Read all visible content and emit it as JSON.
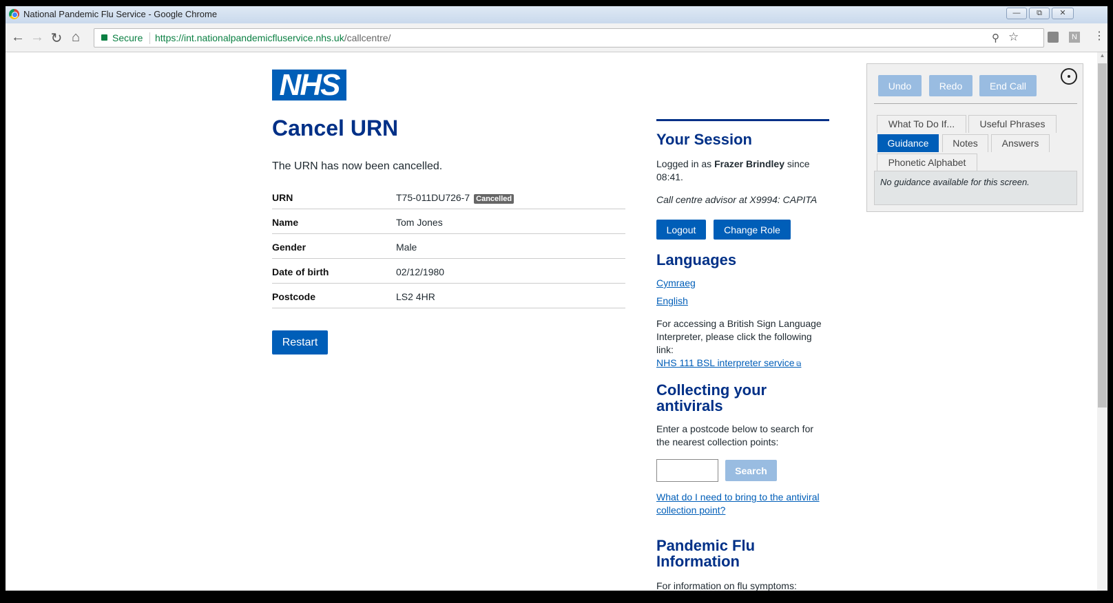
{
  "window": {
    "title": "National Pandemic Flu Service - Google Chrome"
  },
  "browser": {
    "secure_label": "Secure",
    "url_host": "https://int.nationalpandemicfluservice.nhs.uk",
    "url_path": "/callcentre/",
    "ext_n": "N"
  },
  "logo": "NHS",
  "main": {
    "title": "Cancel URN",
    "message": "The URN has now been cancelled.",
    "rows": [
      {
        "label": "URN",
        "value": "T75-011DU726-7",
        "badge": "Cancelled"
      },
      {
        "label": "Name",
        "value": "Tom Jones"
      },
      {
        "label": "Gender",
        "value": "Male"
      },
      {
        "label": "Date of birth",
        "value": "02/12/1980"
      },
      {
        "label": "Postcode",
        "value": "LS2 4HR"
      }
    ],
    "restart": "Restart"
  },
  "session": {
    "heading": "Your Session",
    "logged_pre": "Logged in as",
    "user": "Frazer Brindley",
    "logged_post": "since 08:41.",
    "role": "Call centre advisor at X9994: CAPITA",
    "logout": "Logout",
    "change_role": "Change Role"
  },
  "languages": {
    "heading": "Languages",
    "items": [
      "Cymraeg",
      "English"
    ],
    "bsl_text": "For accessing a British Sign Language Interpreter, please click the following link:",
    "bsl_link": "NHS 111 BSL interpreter service"
  },
  "collect": {
    "heading": "Collecting your antivirals",
    "text": "Enter a postcode below to search for the nearest collection points:",
    "postcode_value": "",
    "search": "Search",
    "link": "What do I need to bring to the antiviral collection point?"
  },
  "flu": {
    "heading": "Pandemic Flu Information",
    "text": "For information on flu symptoms:"
  },
  "panel": {
    "undo": "Undo",
    "redo": "Redo",
    "end_call": "End Call",
    "tabs": [
      "What To Do If...",
      "Useful Phrases",
      "Guidance",
      "Notes",
      "Answers",
      "Phonetic Alphabet"
    ],
    "active_tab": "Guidance",
    "content": "No guidance available for this screen."
  }
}
